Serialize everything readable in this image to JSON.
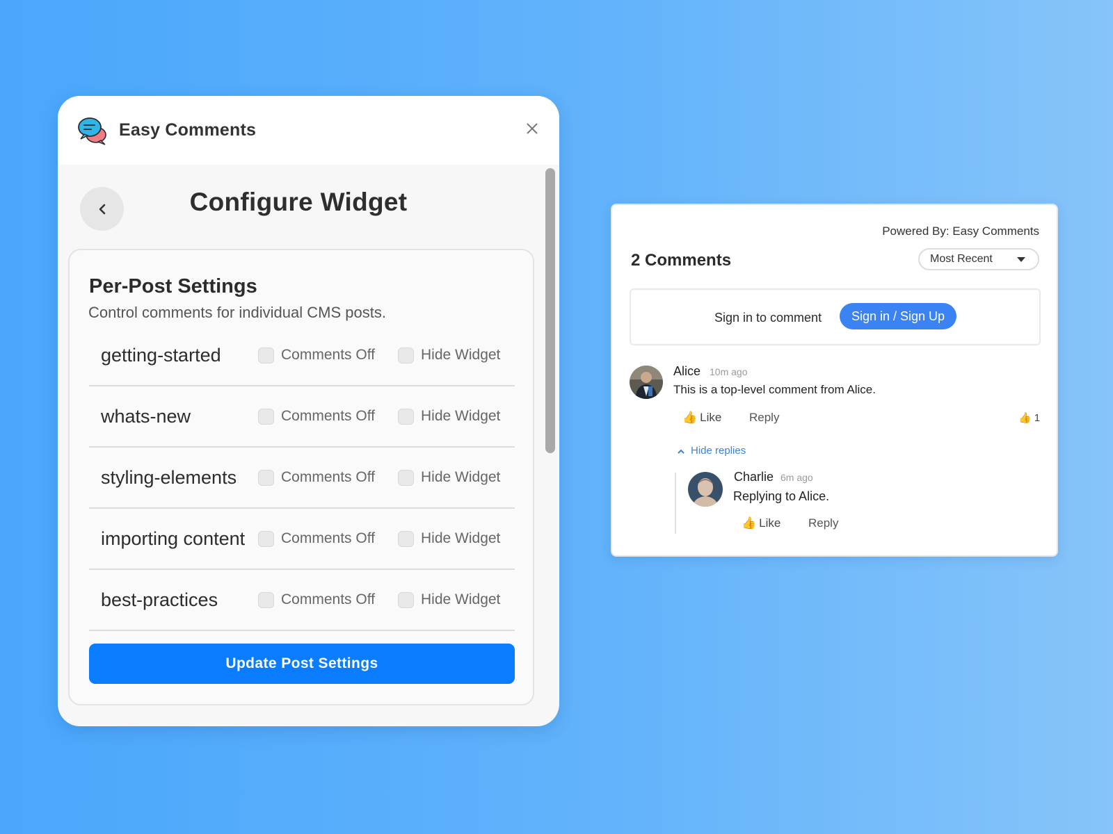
{
  "config": {
    "app_name": "Easy Comments",
    "title": "Configure Widget",
    "settings_heading": "Per-Post Settings",
    "settings_sub": "Control comments for individual CMS posts.",
    "option_comments_off": "Comments Off",
    "option_hide_widget": "Hide Widget",
    "posts": [
      {
        "name": "getting-started",
        "comments_off": false,
        "hide_widget": false
      },
      {
        "name": "whats-new",
        "comments_off": false,
        "hide_widget": false
      },
      {
        "name": "styling-elements",
        "comments_off": false,
        "hide_widget": false
      },
      {
        "name": "importing content",
        "comments_off": false,
        "hide_widget": false
      },
      {
        "name": "best-practices",
        "comments_off": false,
        "hide_widget": false
      }
    ],
    "update_button": "Update Post Settings"
  },
  "widget": {
    "powered_by": "Powered By: Easy Comments",
    "comment_count": "2 Comments",
    "sort_selected": "Most Recent",
    "signin_prompt": "Sign in to comment",
    "signin_button": "Sign in / Sign Up",
    "comments": [
      {
        "author": "Alice",
        "time": "10m ago",
        "text": "This is a top-level comment from Alice.",
        "like_label": "Like",
        "reply_label": "Reply",
        "like_count": "1"
      }
    ],
    "hide_replies": "Hide replies",
    "replies": [
      {
        "author": "Charlie",
        "time": "6m ago",
        "text": "Replying to Alice.",
        "like_label": "Like",
        "reply_label": "Reply"
      }
    ]
  },
  "icons": {
    "logo": "chat-bubbles-icon",
    "close": "close-icon",
    "back": "chevron-left-icon",
    "caret": "caret-down-icon",
    "like": "thumbs-up-icon",
    "collapse": "chevron-up-icon"
  },
  "colors": {
    "primary_button": "#0a7cff",
    "signin_button": "#3b82f2",
    "link": "#3b82d6"
  }
}
